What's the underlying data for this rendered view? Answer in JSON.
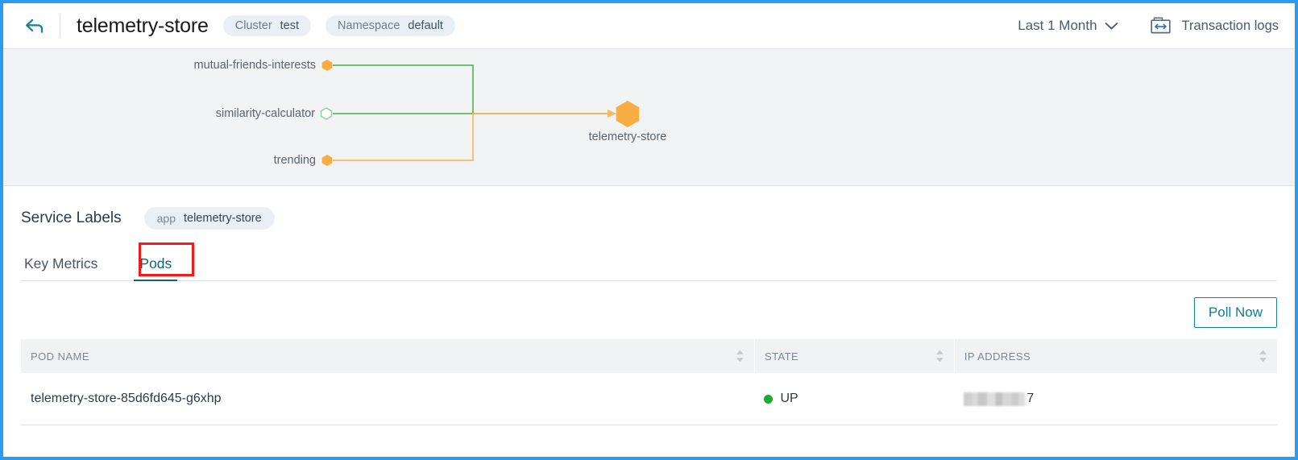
{
  "colors": {
    "accent_teal": "#17616e",
    "link_teal": "#0e7c99",
    "annotation_red": "#f01b1b",
    "node_orange": "#f7ad42",
    "edge_green": "#57b濃"
  },
  "header": {
    "back_icon": "back-arrow-icon",
    "title": "telemetry-store",
    "chips": [
      {
        "key": "Cluster",
        "value": "test"
      },
      {
        "key": "Namespace",
        "value": "default"
      }
    ],
    "time_range": {
      "label": "Last 1 Month",
      "chevron_icon": "chevron-down-icon"
    },
    "transaction_logs": {
      "label": "Transaction logs",
      "icon": "transaction-logs-icon"
    }
  },
  "topology": {
    "nodes": [
      {
        "id": "mutual-friends-interests",
        "label": "mutual-friends-interests",
        "shape": "hexagon",
        "fill": "#f7ad42",
        "hollow": false
      },
      {
        "id": "similarity-calculator",
        "label": "similarity-calculator",
        "shape": "hexagon",
        "fill": "none",
        "hollow": true
      },
      {
        "id": "trending",
        "label": "trending",
        "shape": "hexagon",
        "fill": "#f7ad42",
        "hollow": false
      },
      {
        "id": "telemetry-store",
        "label": "telemetry-store",
        "shape": "hexagon",
        "fill": "#f7ad42",
        "hollow": false
      }
    ],
    "edges": [
      {
        "from": "mutual-friends-interests",
        "to": "telemetry-store",
        "color": "#5cb85c"
      },
      {
        "from": "similarity-calculator",
        "to": "telemetry-store",
        "color": "#5cb85c"
      },
      {
        "from": "trending",
        "to": "telemetry-store",
        "color": "#f5b960"
      }
    ]
  },
  "service_labels": {
    "title": "Service Labels",
    "tags": [
      {
        "key": "app",
        "value": "telemetry-store"
      }
    ]
  },
  "tabs": {
    "items": [
      {
        "id": "key-metrics",
        "label": "Key Metrics",
        "active": false
      },
      {
        "id": "pods",
        "label": "Pods",
        "active": true
      }
    ]
  },
  "actions": {
    "poll_now": "Poll Now"
  },
  "pods_table": {
    "columns": [
      {
        "id": "pod-name",
        "label": "POD NAME",
        "sortable": true
      },
      {
        "id": "state",
        "label": "STATE",
        "sortable": true
      },
      {
        "id": "ip-address",
        "label": "IP ADDRESS",
        "sortable": true
      }
    ],
    "rows": [
      {
        "pod_name": "telemetry-store-85d6fd645-g6xhp",
        "state": "UP",
        "state_color": "#1ea832",
        "ip_address_redacted": true,
        "ip_address_visible_tail": "7"
      }
    ]
  }
}
